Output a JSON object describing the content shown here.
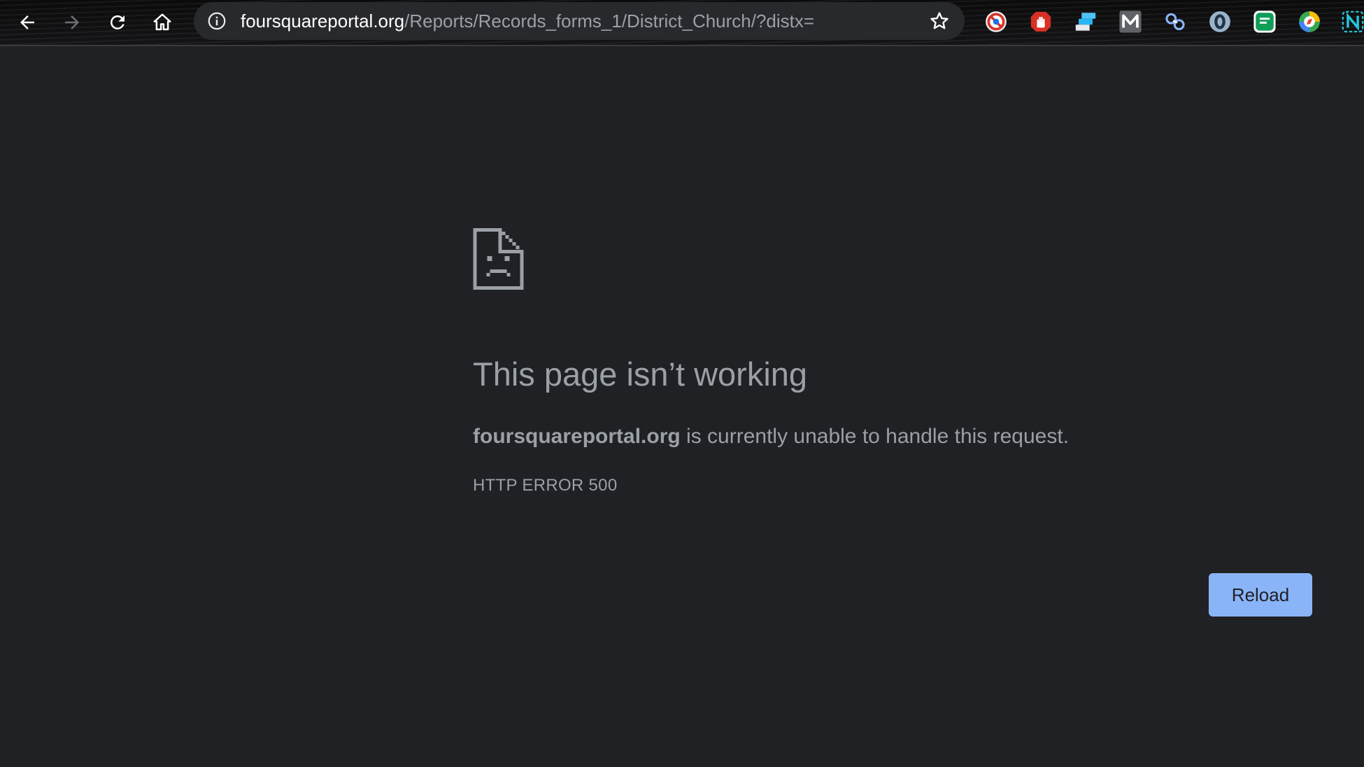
{
  "toolbar": {
    "nav_icons": [
      "back-arrow-icon",
      "forward-arrow-icon",
      "reload-icon",
      "home-icon"
    ],
    "address_bar": {
      "host": "foursquareportal.org",
      "path": "/Reports/Records_forms_1/District_Church/?distx="
    },
    "extensions": [
      "blocked-circle-icon",
      "red-hand-icon",
      "blue-stack-icon",
      "m-letter-icon",
      "link-chain-icon",
      "circle-o-icon",
      "green-chat-icon",
      "compass-icon",
      "n-letter-icon"
    ]
  },
  "error_page": {
    "heading": "This page isn’t working",
    "message_host": "foursquareportal.org",
    "message_rest": " is currently unable to handle this request.",
    "error_code": "HTTP ERROR 500",
    "reload_label": "Reload"
  },
  "colors": {
    "background": "#202124",
    "text": "#9aa0a6",
    "button": "#8ab4f8"
  }
}
